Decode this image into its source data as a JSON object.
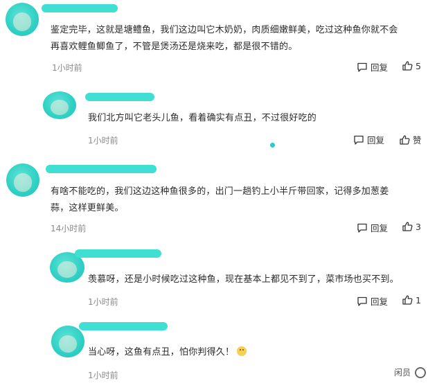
{
  "comments": [
    {
      "text_line1": "鉴定完毕，这就是塘鳢鱼，我们这边叫它木奶奶，肉质细嫩鲜美，吃过这种鱼你就不会",
      "text_line2": "再喜欢鲤鱼鲫鱼了，不管是煲汤还是烧来吃，都是很不错的。",
      "time": "1小时前",
      "reply_label": "回复",
      "like_count": "5",
      "like_icon": "thumbs-up-icon",
      "reply_icon": "speech-bubble-icon"
    },
    {
      "text_line1": "我们北方叫它老头儿鱼，看着确实有点丑，不过很好吃的",
      "time": "1小时前",
      "reply_label": "回复",
      "like_label": "赞",
      "like_icon": "thumbs-up-icon",
      "reply_icon": "speech-bubble-icon"
    },
    {
      "text_line1": "有啥不能吃的，我们这边这种鱼很多的，出门一趟钓上小半斤带回家，记得多加葱姜",
      "text_line2": "蒜，这样更鲜美。",
      "time": "14小时前",
      "reply_label": "回复",
      "like_count": "3",
      "like_icon": "thumbs-up-icon",
      "reply_icon": "speech-bubble-icon"
    },
    {
      "text_line1": "羡慕呀，还是小时候吃过这种鱼，现在基本上都见不到了，菜市场也买不到。",
      "time": "1小时前",
      "reply_label": "回复",
      "like_count": "1",
      "like_icon": "thumbs-up-icon",
      "reply_icon": "speech-bubble-icon"
    },
    {
      "text_line1": "当心呀，这鱼有点丑，怕你判得久！",
      "time": "1小时前",
      "emoji": "grimace-emoji-icon"
    }
  ],
  "watermark": {
    "label": "闲员",
    "icon": "watermark-circle-icon"
  },
  "colors": {
    "redaction": "#3fe0d3",
    "accent_dot": "#2fc7c8",
    "time": "#8a8a8a"
  }
}
